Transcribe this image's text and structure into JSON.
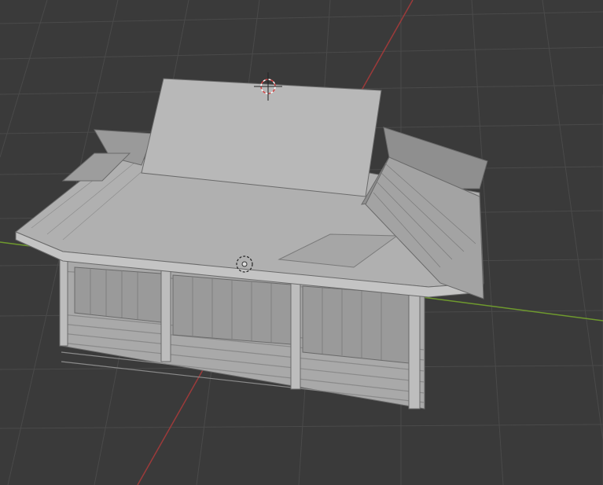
{
  "viewport": {
    "label": "",
    "background_color": "#3a3a3a",
    "grid_color": "#4a4a4a",
    "x_axis_color": "#9c3a3a",
    "y_axis_color": "#6f9a2e",
    "model_fill": "#b8b8b8",
    "model_shadow": "#8e8e8e",
    "model_stroke": "#6a6a6a"
  },
  "scene": {
    "object": "temple-house-model",
    "cursor_3d": "3d-cursor-icon",
    "object_origin": "origin-marker-icon"
  }
}
